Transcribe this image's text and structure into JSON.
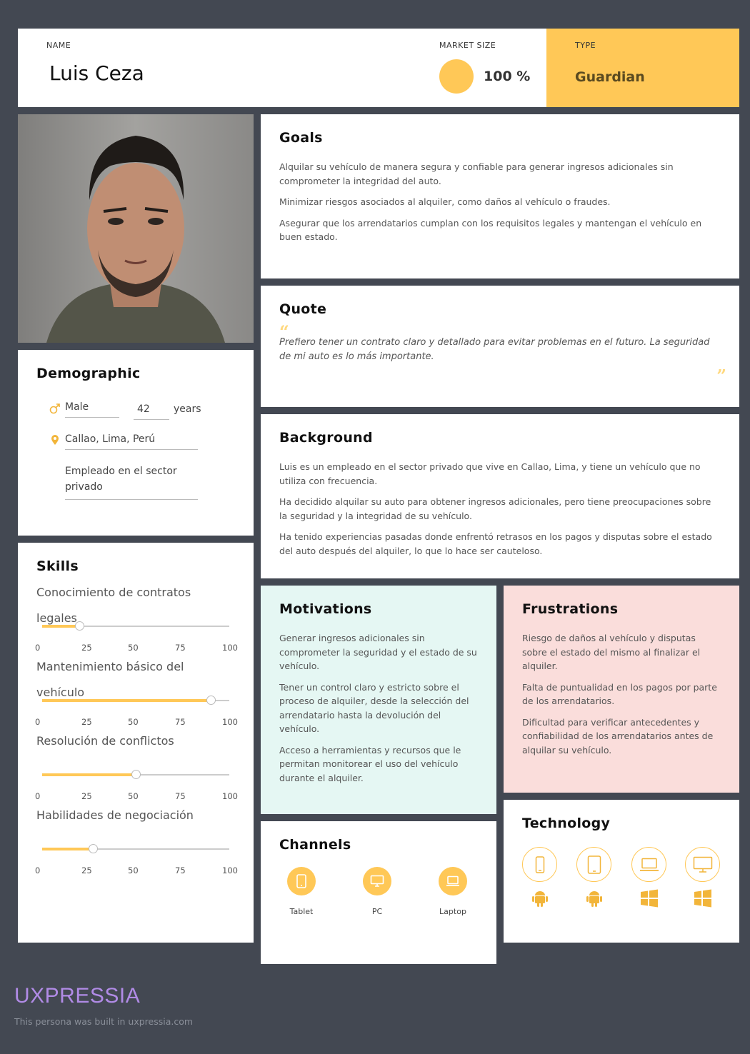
{
  "header": {
    "name_label": "NAME",
    "name": "Luis Ceza",
    "market_size_label": "MARKET SIZE",
    "market_size": "100 %",
    "type_label": "TYPE",
    "type": "Guardian"
  },
  "colors": {
    "accent": "#ffc857",
    "background": "#434852",
    "motivations_bg": "#e5f7f3",
    "frustrations_bg": "#fadddb",
    "brand": "#b18be6"
  },
  "demographic": {
    "title": "Demographic",
    "gender": "Male",
    "age": "42",
    "age_unit": "years",
    "location": "Callao, Lima, Perú",
    "occupation": "Empleado en el sector privado"
  },
  "skills": {
    "title": "Skills",
    "ticks": [
      "0",
      "25",
      "50",
      "75",
      "100"
    ],
    "items": [
      {
        "label": "Conocimiento de contratos legales",
        "value": 20
      },
      {
        "label": "Mantenimiento básico del vehículo",
        "value": 90
      },
      {
        "label": "Resolución de conflictos",
        "value": 50
      },
      {
        "label": "Habilidades de negociación",
        "value": 27
      }
    ]
  },
  "goals": {
    "title": "Goals",
    "items": [
      "Alquilar su vehículo de manera segura y confiable para generar ingresos adicionales sin comprometer la integridad del auto.",
      "Minimizar riesgos asociados al alquiler, como daños al vehículo o fraudes.",
      "Asegurar que los arrendatarios cumplan con los requisitos legales y mantengan el vehículo en buen estado."
    ]
  },
  "quote": {
    "title": "Quote",
    "text": "Prefiero tener un contrato claro y detallado para evitar problemas en el futuro. La seguridad de mi auto es lo más importante."
  },
  "background": {
    "title": "Background",
    "items": [
      "Luis es un empleado en el sector privado que vive en Callao, Lima, y tiene un vehículo que no utiliza con frecuencia.",
      "Ha decidido alquilar su auto para obtener ingresos adicionales, pero tiene preocupaciones sobre la seguridad y la integridad de su vehículo.",
      "Ha tenido experiencias pasadas donde enfrentó retrasos en los pagos y disputas sobre el estado del auto después del alquiler, lo que lo hace ser cauteloso."
    ]
  },
  "motivations": {
    "title": "Motivations",
    "items": [
      "Generar ingresos adicionales sin comprometer la seguridad y el estado de su vehículo.",
      "Tener un control claro y estricto sobre el proceso de alquiler, desde la selección del arrendatario hasta la devolución del vehículo.",
      "Acceso a herramientas y recursos que le permitan monitorear el uso del vehículo durante el alquiler."
    ]
  },
  "frustrations": {
    "title": "Frustrations",
    "items": [
      "Riesgo de daños al vehículo y disputas sobre el estado del mismo al finalizar el alquiler.",
      "Falta de puntualidad en los pagos por parte de los arrendatarios.",
      "Dificultad para verificar antecedentes y confiabilidad de los arrendatarios antes de alquilar su vehículo."
    ]
  },
  "channels": {
    "title": "Channels",
    "items": [
      {
        "label": "Tablet",
        "icon": "tablet-icon"
      },
      {
        "label": "PC",
        "icon": "pc-icon"
      },
      {
        "label": "Laptop",
        "icon": "laptop-icon"
      }
    ]
  },
  "technology": {
    "title": "Technology",
    "devices": [
      {
        "device": "phone-icon",
        "os": "android-icon"
      },
      {
        "device": "tablet-icon",
        "os": "android-icon"
      },
      {
        "device": "laptop-icon",
        "os": "windows-icon"
      },
      {
        "device": "monitor-icon",
        "os": "windows-icon"
      }
    ]
  },
  "footer": {
    "brand": "UXPRESSIA",
    "credit": "This persona was built in uxpressia.com"
  }
}
